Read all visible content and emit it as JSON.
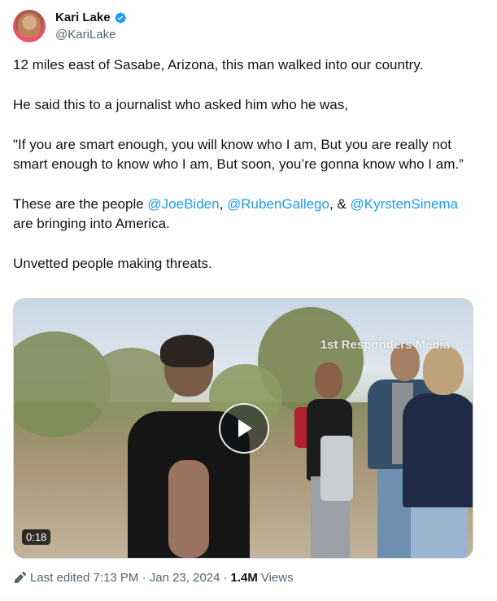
{
  "author": {
    "display_name": "Kari Lake",
    "handle": "@KariLake"
  },
  "tweet": {
    "paragraph_1": "12 miles east of Sasabe, Arizona, this man walked into our country.",
    "paragraph_2": "He said this to a journalist who asked him who he was,",
    "paragraph_3": "\"If you are smart enough, you will know who I am, But you are really not smart enough to know who I am, But soon, you’re gonna know who I am.”",
    "paragraph_4_prefix": "These are the people ",
    "mention_1": "@JoeBiden",
    "sep_1": ", ",
    "mention_2": "@RubenGallego",
    "sep_2": ", & ",
    "mention_3": "@KyrstenSinema",
    "paragraph_4_suffix": " are bringing into America.",
    "paragraph_5": "Unvetted people making threats."
  },
  "media": {
    "watermark": "1st Responders Media",
    "duration": "0:18",
    "play_icon": "play-icon"
  },
  "meta": {
    "edited_label": "Last edited 7:13 PM · Jan 23, 2024",
    "separator": "·",
    "views_count": "1.4M",
    "views_label": "Views"
  },
  "colors": {
    "link": "#1d9bf0",
    "verified": "#1d9bf0",
    "secondary_text": "#536471"
  }
}
